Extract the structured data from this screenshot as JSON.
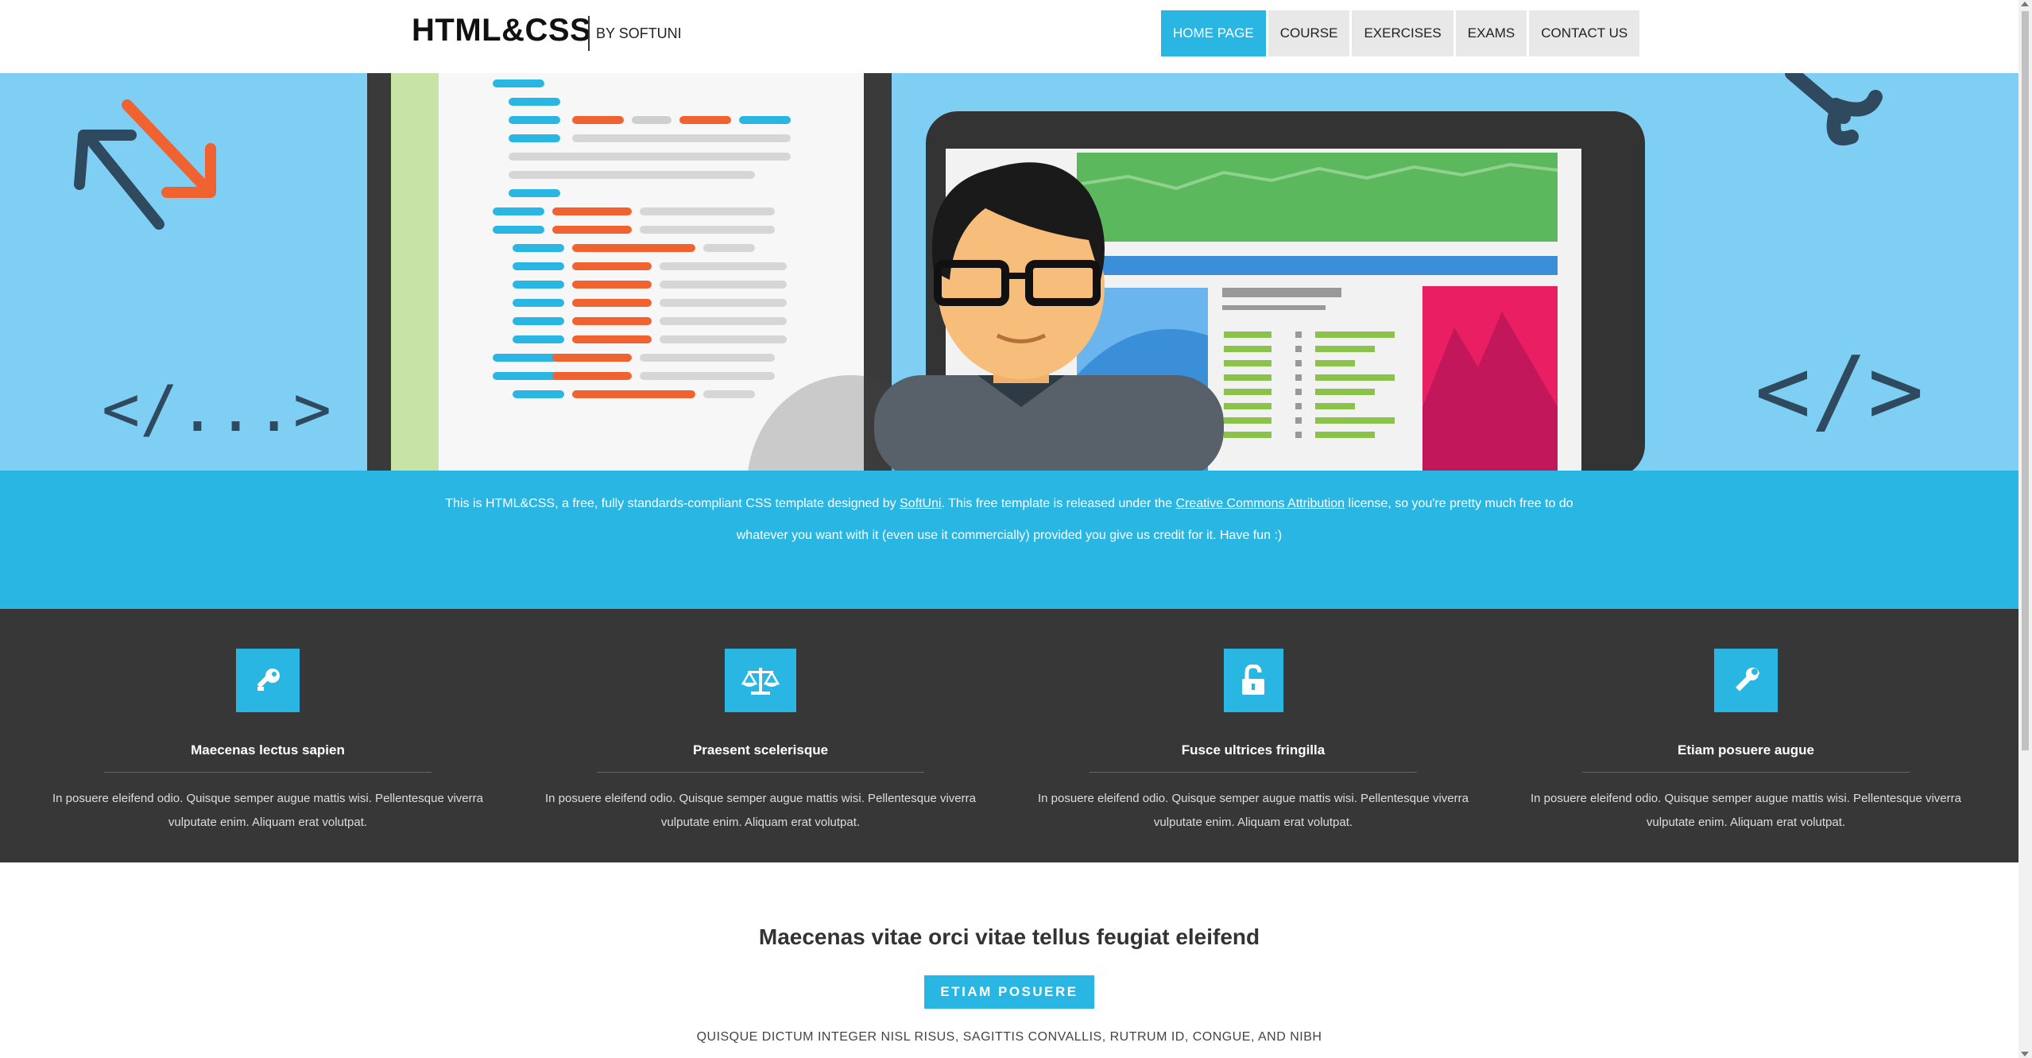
{
  "header": {
    "logo": "HTML&CSS",
    "subtitle": "BY SOFTUNI",
    "nav": [
      {
        "label": "HOME PAGE",
        "active": true
      },
      {
        "label": "COURSE",
        "active": false
      },
      {
        "label": "EXERCISES",
        "active": false
      },
      {
        "label": "EXAMS",
        "active": false
      },
      {
        "label": "CONTACT US",
        "active": false
      }
    ]
  },
  "hero": {
    "left_tag": "</...>",
    "right_tag": "</>"
  },
  "intro": {
    "text_1": "This is HTML&CSS, a free, fully standards-compliant CSS template designed by ",
    "link_1": "SoftUni",
    "text_2": ". This free template is released under the ",
    "link_2": "Creative Commons Attribution",
    "text_3": " license, so you're pretty much free to do",
    "text_4": "whatever you want with it (even use it commercially) provided you give us credit for it. Have fun :)"
  },
  "features": [
    {
      "icon": "key-icon",
      "title": "Maecenas lectus sapien",
      "text_1": "In posuere eleifend odio. Quisque semper augue mattis wisi. Pellentesque viverra",
      "text_2": "vulputate enim. Aliquam erat volutpat."
    },
    {
      "icon": "balance-scale-icon",
      "title": "Praesent scelerisque",
      "text_1": "In posuere eleifend odio. Quisque semper augue mattis wisi. Pellentesque viverra",
      "text_2": "vulputate enim. Aliquam erat volutpat."
    },
    {
      "icon": "unlock-icon",
      "title": "Fusce ultrices fringilla",
      "text_1": "In posuere eleifend odio. Quisque semper augue mattis wisi. Pellentesque viverra",
      "text_2": "vulputate enim. Aliquam erat volutpat."
    },
    {
      "icon": "wrench-icon",
      "title": "Etiam posuere augue",
      "text_1": "In posuere eleifend odio. Quisque semper augue mattis wisi. Pellentesque viverra",
      "text_2": "vulputate enim. Aliquam erat volutpat."
    }
  ],
  "bottom": {
    "title": "Maecenas vitae orci vitae tellus feugiat eleifend",
    "button": "ETIAM POSUERE",
    "subtitle": "QUISQUE DICTUM INTEGER NISL RISUS, SAGITTIS CONVALLIS, RUTRUM ID, CONGUE, AND NIBH"
  },
  "colors": {
    "accent": "#29b6e3",
    "hero_bg": "#7fcff4",
    "dark_band": "#373737"
  }
}
